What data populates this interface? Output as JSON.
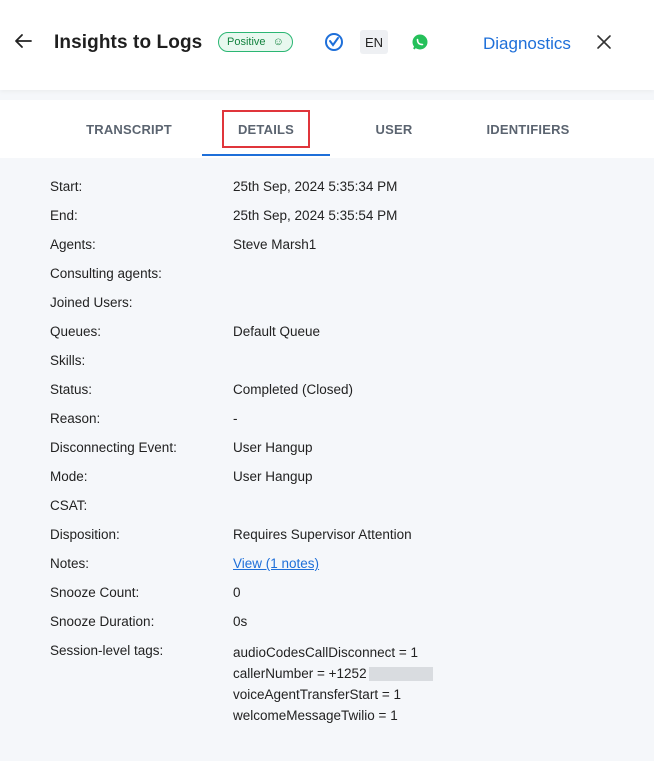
{
  "header": {
    "title": "Insights to Logs",
    "sentiment_badge": "Positive",
    "language": "EN",
    "diagnostics_label": "Diagnostics",
    "icons": {
      "back": "back-arrow-icon",
      "smile": "smile-icon",
      "check": "check-circle-icon",
      "channel": "whatsapp-icon",
      "close": "close-icon"
    },
    "colors": {
      "badge_border": "#2bb673",
      "badge_text": "#13833f",
      "link": "#1e6fd9",
      "whatsapp": "#25c05a"
    }
  },
  "tabs": [
    {
      "label": "TRANSCRIPT"
    },
    {
      "label": "DETAILS",
      "active": true
    },
    {
      "label": "USER"
    },
    {
      "label": "IDENTIFIERS"
    }
  ],
  "details": [
    {
      "label": "Start:",
      "value": "25th Sep, 2024 5:35:34 PM"
    },
    {
      "label": "End:",
      "value": "25th Sep, 2024 5:35:54 PM"
    },
    {
      "label": "Agents:",
      "value": "Steve Marsh1"
    },
    {
      "label": "Consulting agents:",
      "value": ""
    },
    {
      "label": "Joined Users:",
      "value": ""
    },
    {
      "label": "Queues:",
      "value": "Default Queue"
    },
    {
      "label": "Skills:",
      "value": ""
    },
    {
      "label": "Status:",
      "value": "Completed (Closed)"
    },
    {
      "label": "Reason:",
      "value": "-"
    },
    {
      "label": "Disconnecting Event:",
      "value": "User Hangup"
    },
    {
      "label": "Mode:",
      "value": "User Hangup"
    },
    {
      "label": "CSAT:",
      "value": ""
    },
    {
      "label": "Disposition:",
      "value": "Requires Supervisor Attention"
    },
    {
      "label": "Notes:",
      "value": "View (1 notes)"
    },
    {
      "label": "Snooze Count:",
      "value": "0"
    },
    {
      "label": "Snooze Duration:",
      "value": "0s"
    },
    {
      "label": "Session-level tags:",
      "value": ""
    }
  ],
  "session_tags": [
    "audioCodesCallDisconnect = 1",
    "callerNumber = +1252",
    "voiceAgentTransferStart = 1",
    "welcomeMessageTwilio = 1"
  ]
}
